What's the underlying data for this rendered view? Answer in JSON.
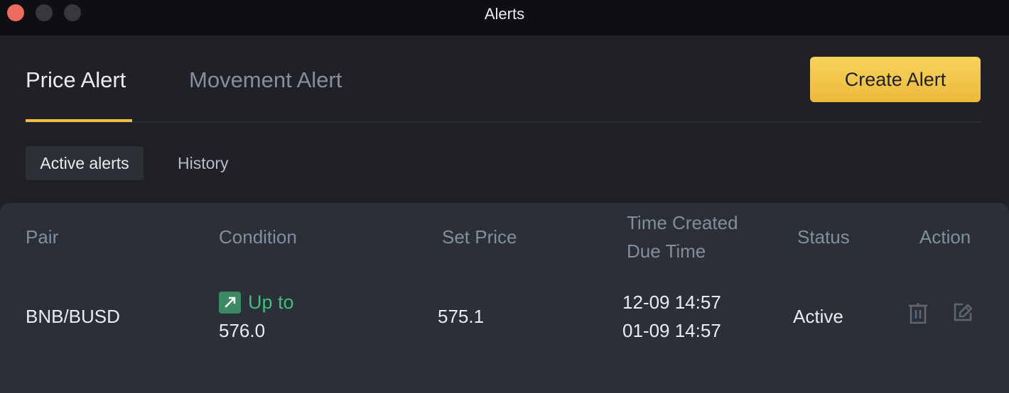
{
  "window": {
    "title": "Alerts",
    "traffic_lights": [
      "close",
      "minimize",
      "maximize"
    ]
  },
  "main_tabs": [
    {
      "label": "Price Alert",
      "active": true
    },
    {
      "label": "Movement Alert",
      "active": false
    }
  ],
  "create_button": {
    "label": "Create Alert"
  },
  "sub_tabs": [
    {
      "label": "Active alerts",
      "active": true
    },
    {
      "label": "History",
      "active": false
    }
  ],
  "table": {
    "headers": {
      "pair": "Pair",
      "condition": "Condition",
      "set_price": "Set Price",
      "time_created": "Time Created",
      "due_time": "Due Time",
      "status": "Status",
      "action": "Action"
    },
    "rows": [
      {
        "pair": "BNB/BUSD",
        "condition_icon": "arrow-up-right-icon",
        "condition_label": "Up to",
        "condition_value": "576.0",
        "set_price": "575.1",
        "time_created": "12-09 14:57",
        "due_time": "01-09 14:57",
        "status": "Active",
        "actions": [
          "trash-icon",
          "edit-icon"
        ]
      }
    ]
  },
  "colors": {
    "accent": "#eebf3f",
    "up": "#3fbe7f",
    "background": "#1f2126",
    "panel": "#2b2f37"
  }
}
